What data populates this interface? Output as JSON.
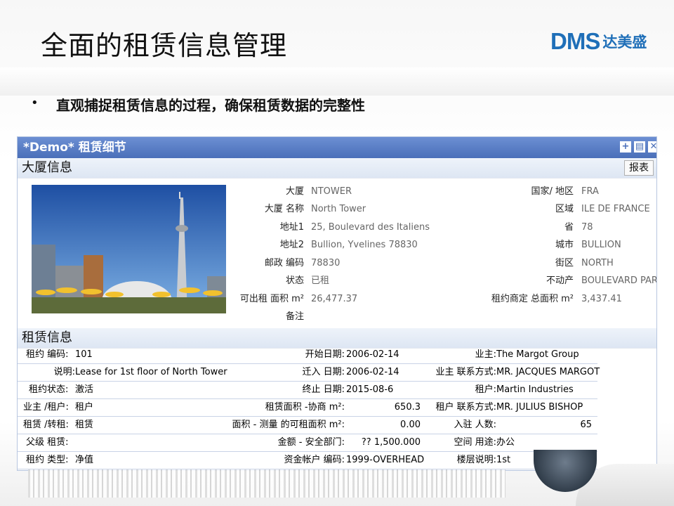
{
  "slide": {
    "title": "全面的租赁信息管理",
    "bullet_mark": "•",
    "bullet_text": "直观捕捉租赁信息的过程，确保租赁数据的完整性",
    "logo_latin": "DMS",
    "logo_cn": "达美盛"
  },
  "panel": {
    "title": "*Demo* 租赁细节",
    "icons": [
      "add-icon",
      "print-icon",
      "close-icon"
    ],
    "building_section": {
      "title": "大厦信息",
      "report_button": "报表",
      "left_fields": [
        {
          "label": "大厦",
          "value": "NTOWER"
        },
        {
          "label": "大厦 名称",
          "value": "North Tower"
        },
        {
          "label": "地址1",
          "value": "25, Boulevard des Italiens"
        },
        {
          "label": "地址2",
          "value": "Bullion, Yvelines 78830"
        },
        {
          "label": "邮政 编码",
          "value": "78830"
        },
        {
          "label": "状态",
          "value": "已租"
        },
        {
          "label": "可出租 面积 m²",
          "value": "26,477.37"
        },
        {
          "label": "备注",
          "value": ""
        }
      ],
      "right_fields": [
        {
          "label": "国家/ 地区",
          "value": "FRA"
        },
        {
          "label": "区域",
          "value": "ILE DE FRANCE"
        },
        {
          "label": "省",
          "value": "78"
        },
        {
          "label": "城市",
          "value": "BULLION"
        },
        {
          "label": "街区",
          "value": "NORTH"
        },
        {
          "label": "不动产",
          "value": "BOULEVARD PARK"
        },
        {
          "label": "租约商定 总面积 m²",
          "value": "3,437.41"
        }
      ]
    },
    "lease_section": {
      "title": "租赁信息",
      "rows": [
        {
          "c1l": "租约 编码:",
          "c1v": "101",
          "c2l": "开始日期:",
          "c2v": "2006-02-14",
          "c3l": "业主:",
          "c3v": "The Margot Group"
        },
        {
          "c1l": "说明:",
          "c1v": "Lease for 1st floor of North Tower",
          "c2l": "迁入 日期:",
          "c2v": "2006-02-14",
          "c3l": "业主 联系方式:",
          "c3v": "MR. JACQUES MARGOT"
        },
        {
          "c1l": "租约状态:",
          "c1v": "激活",
          "c2l": "终止 日期:",
          "c2v": "2015-08-6",
          "c3l": "租户:",
          "c3v": "Martin Industries"
        },
        {
          "c1l": "业主 /租户:",
          "c1v": "租户",
          "c2l": "租赁面积 -协商 m²:",
          "c2v": "650.3",
          "c3l": "租户 联系方式:",
          "c3v": "MR. JULIUS BISHOP"
        },
        {
          "c1l": "租赁 /转租:",
          "c1v": "租赁",
          "c2l": "面积 - 测量 的可租面积 m²:",
          "c2v": "0.00",
          "c3l": "入驻 人数:",
          "c3v": "65"
        },
        {
          "c1l": "父级 租赁:",
          "c1v": "",
          "c2l": "金额 - 安全部门:",
          "c2v": "?? 1,500.000",
          "c3l": "空间 用途:",
          "c3v": "办公"
        },
        {
          "c1l": "租约 类型:",
          "c1v": "净值",
          "c2l": "资金帐户 编码:",
          "c2v": "1999-OVERHEAD",
          "c3l": "楼层说明:",
          "c3v": "1st"
        }
      ]
    }
  }
}
